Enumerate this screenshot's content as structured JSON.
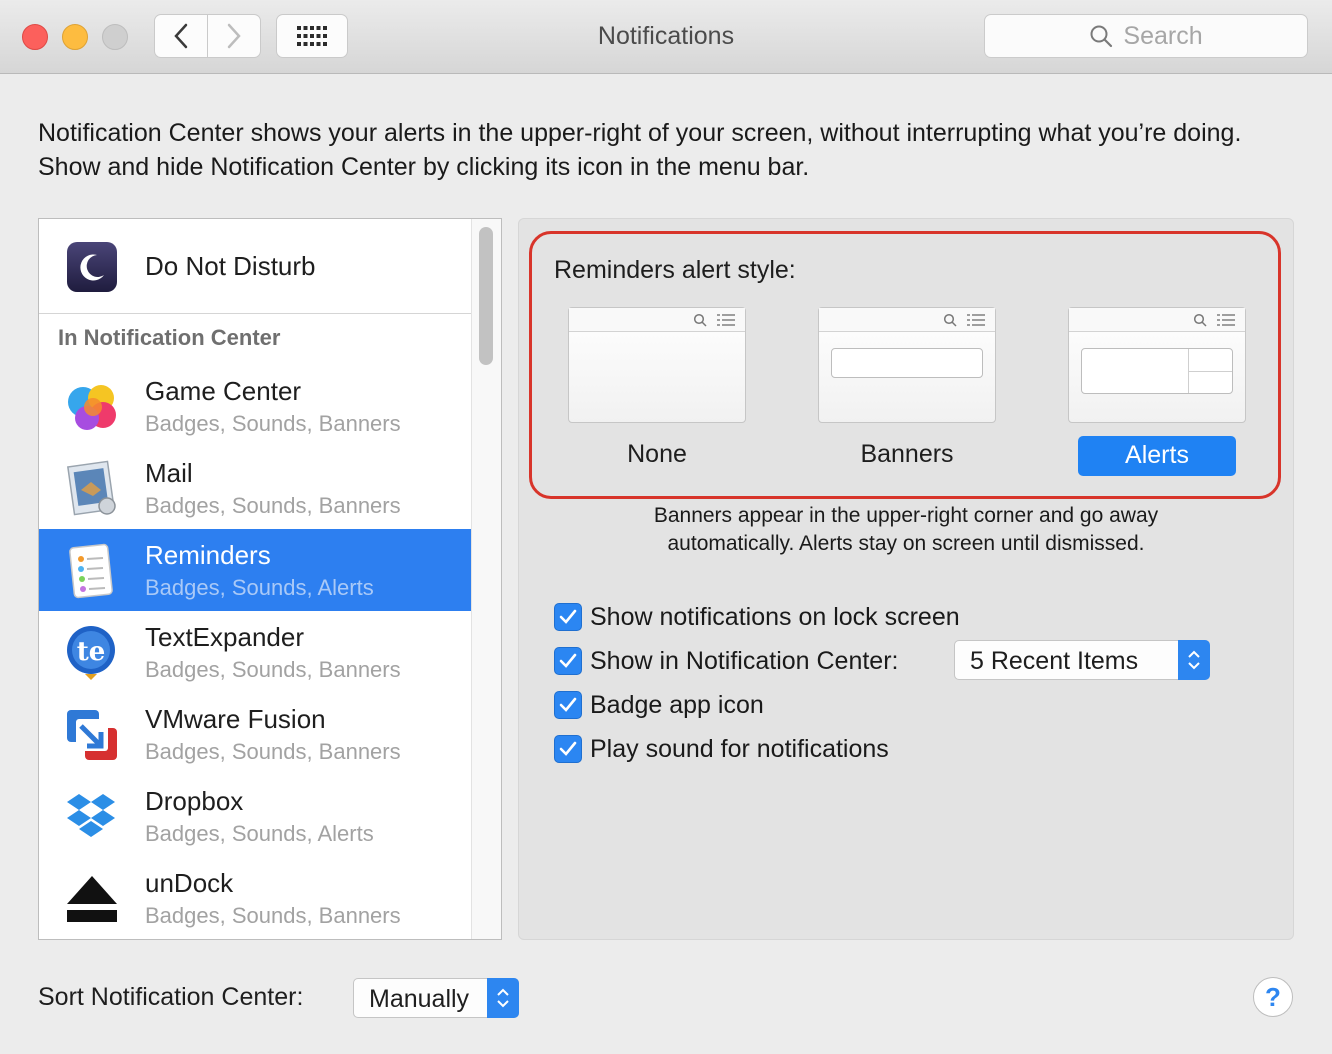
{
  "window": {
    "title": "Notifications"
  },
  "toolbar": {
    "search_placeholder": "Search"
  },
  "intro": "Notification Center shows your alerts in the upper-right of your screen, without interrupting what you’re doing. Show and hide Notification Center by clicking its icon in the menu bar.",
  "sidebar": {
    "dnd_label": "Do Not Disturb",
    "section_label": "In Notification Center",
    "items": [
      {
        "name": "Game Center",
        "sub": "Badges, Sounds, Banners",
        "icon": "game-center-icon",
        "selected": false
      },
      {
        "name": "Mail",
        "sub": "Badges, Sounds, Banners",
        "icon": "mail-icon",
        "selected": false
      },
      {
        "name": "Reminders",
        "sub": "Badges, Sounds, Alerts",
        "icon": "reminders-icon",
        "selected": true
      },
      {
        "name": "TextExpander",
        "sub": "Badges, Sounds, Banners",
        "icon": "textexpander-icon",
        "selected": false
      },
      {
        "name": "VMware Fusion",
        "sub": "Badges, Sounds, Banners",
        "icon": "vmware-fusion-icon",
        "selected": false
      },
      {
        "name": "Dropbox",
        "sub": "Badges, Sounds, Alerts",
        "icon": "dropbox-icon",
        "selected": false
      },
      {
        "name": "unDock",
        "sub": "Badges, Sounds, Banners",
        "icon": "undock-icon",
        "selected": false
      }
    ]
  },
  "detail": {
    "alert_style_title": "Reminders alert style:",
    "options": [
      "None",
      "Banners",
      "Alerts"
    ],
    "selected_option": "Alerts",
    "explanation_line1": "Banners appear in the upper-right corner and go away",
    "explanation_line2": "automatically. Alerts stay on screen until dismissed.",
    "checkboxes": [
      {
        "label": "Show notifications on lock screen",
        "checked": true
      },
      {
        "label": "Show in Notification Center:",
        "checked": true
      },
      {
        "label": "Badge app icon",
        "checked": true
      },
      {
        "label": "Play sound for notifications",
        "checked": true
      }
    ],
    "recent_items_value": "5 Recent Items"
  },
  "footer": {
    "sort_label": "Sort Notification Center:",
    "sort_value": "Manually",
    "help": "?"
  },
  "colors": {
    "accent": "#2d7ff0",
    "highlight_border": "#d8342a"
  }
}
